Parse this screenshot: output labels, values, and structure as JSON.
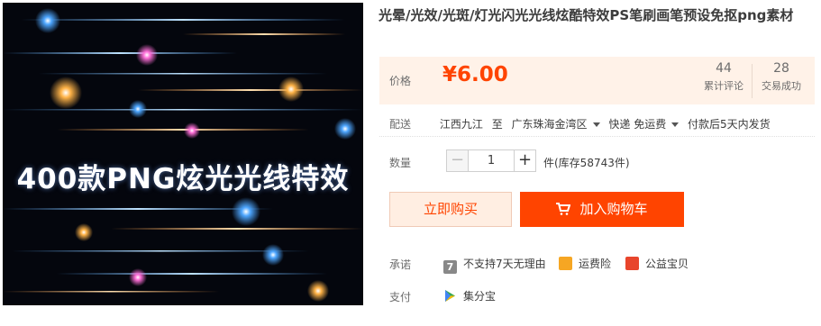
{
  "hero": {
    "caption": "400款PNG炫光光线特效"
  },
  "product": {
    "title": "光晕/光效/光斑/灯光闪光光线炫酷特效PS笔刷画笔预设免抠png素材"
  },
  "price": {
    "label": "价格",
    "value": "¥6.00"
  },
  "stats": [
    {
      "count": "44",
      "label": "累计评论"
    },
    {
      "count": "28",
      "label": "交易成功"
    }
  ],
  "shipping": {
    "label": "配送",
    "from": "江西九江",
    "to_word": "至",
    "destination": "广东珠海金湾区",
    "method": "快递 免运费",
    "dispatch": "付款后5天内发货"
  },
  "quantity": {
    "label": "数量",
    "value": "1",
    "minus": "−",
    "plus": "+",
    "stock": "件(库存58743件)"
  },
  "buttons": {
    "buy_now": "立即购买",
    "add_cart": "加入购物车"
  },
  "promise": {
    "label": "承诺",
    "items": [
      {
        "text": "不支持7天无理由",
        "icon": "seven-day-icon",
        "color": "#888888"
      },
      {
        "text": "运费险",
        "icon": "freight-insurance-icon",
        "color": "#f6a623"
      },
      {
        "text": "公益宝贝",
        "icon": "charity-icon",
        "color": "#e8452c"
      }
    ]
  },
  "payment": {
    "label": "支付",
    "method": "集分宝"
  },
  "colors": {
    "accent": "#ff4400",
    "price_bg": "#fff2e8",
    "buy_now_bg": "#ffeee2"
  }
}
